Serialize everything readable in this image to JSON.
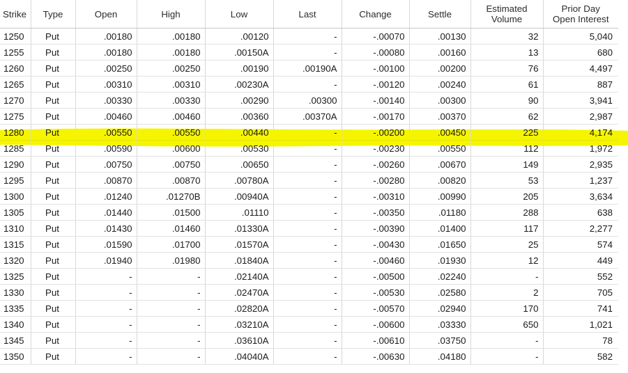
{
  "columns": [
    {
      "label": "Strike",
      "sub": ""
    },
    {
      "label": "Type",
      "sub": ""
    },
    {
      "label": "Open",
      "sub": ""
    },
    {
      "label": "High",
      "sub": ""
    },
    {
      "label": "Low",
      "sub": ""
    },
    {
      "label": "Last",
      "sub": ""
    },
    {
      "label": "Change",
      "sub": ""
    },
    {
      "label": "Settle",
      "sub": ""
    },
    {
      "label": "Estimated",
      "sub": "Volume"
    },
    {
      "label": "Prior Day",
      "sub": "Open Interest"
    }
  ],
  "highlight_color": "#f6f500",
  "highlighted_strike": "1280",
  "rows": [
    {
      "strike": "1250",
      "type": "Put",
      "open": ".00180",
      "high": ".00180",
      "low": ".00120",
      "last": "-",
      "change": "-.00070",
      "settle": ".00130",
      "volume": "32",
      "oi": "5,040"
    },
    {
      "strike": "1255",
      "type": "Put",
      "open": ".00180",
      "high": ".00180",
      "low": ".00150A",
      "last": "-",
      "change": "-.00080",
      "settle": ".00160",
      "volume": "13",
      "oi": "680"
    },
    {
      "strike": "1260",
      "type": "Put",
      "open": ".00250",
      "high": ".00250",
      "low": ".00190",
      "last": ".00190A",
      "change": "-.00100",
      "settle": ".00200",
      "volume": "76",
      "oi": "4,497"
    },
    {
      "strike": "1265",
      "type": "Put",
      "open": ".00310",
      "high": ".00310",
      "low": ".00230A",
      "last": "-",
      "change": "-.00120",
      "settle": ".00240",
      "volume": "61",
      "oi": "887"
    },
    {
      "strike": "1270",
      "type": "Put",
      "open": ".00330",
      "high": ".00330",
      "low": ".00290",
      "last": ".00300",
      "change": "-.00140",
      "settle": ".00300",
      "volume": "90",
      "oi": "3,941"
    },
    {
      "strike": "1275",
      "type": "Put",
      "open": ".00460",
      "high": ".00460",
      "low": ".00360",
      "last": ".00370A",
      "change": "-.00170",
      "settle": ".00370",
      "volume": "62",
      "oi": "2,987"
    },
    {
      "strike": "1280",
      "type": "Put",
      "open": ".00550",
      "high": ".00550",
      "low": ".00440",
      "last": "-",
      "change": "-.00200",
      "settle": ".00450",
      "volume": "225",
      "oi": "4,174"
    },
    {
      "strike": "1285",
      "type": "Put",
      "open": ".00590",
      "high": ".00600",
      "low": ".00530",
      "last": "-",
      "change": "-.00230",
      "settle": ".00550",
      "volume": "112",
      "oi": "1,972"
    },
    {
      "strike": "1290",
      "type": "Put",
      "open": ".00750",
      "high": ".00750",
      "low": ".00650",
      "last": "-",
      "change": "-.00260",
      "settle": ".00670",
      "volume": "149",
      "oi": "2,935"
    },
    {
      "strike": "1295",
      "type": "Put",
      "open": ".00870",
      "high": ".00870",
      "low": ".00780A",
      "last": "-",
      "change": "-.00280",
      "settle": ".00820",
      "volume": "53",
      "oi": "1,237"
    },
    {
      "strike": "1300",
      "type": "Put",
      "open": ".01240",
      "high": ".01270B",
      "low": ".00940A",
      "last": "-",
      "change": "-.00310",
      "settle": ".00990",
      "volume": "205",
      "oi": "3,634"
    },
    {
      "strike": "1305",
      "type": "Put",
      "open": ".01440",
      "high": ".01500",
      "low": ".01110",
      "last": "-",
      "change": "-.00350",
      "settle": ".01180",
      "volume": "288",
      "oi": "638"
    },
    {
      "strike": "1310",
      "type": "Put",
      "open": ".01430",
      "high": ".01460",
      "low": ".01330A",
      "last": "-",
      "change": "-.00390",
      "settle": ".01400",
      "volume": "117",
      "oi": "2,277"
    },
    {
      "strike": "1315",
      "type": "Put",
      "open": ".01590",
      "high": ".01700",
      "low": ".01570A",
      "last": "-",
      "change": "-.00430",
      "settle": ".01650",
      "volume": "25",
      "oi": "574"
    },
    {
      "strike": "1320",
      "type": "Put",
      "open": ".01940",
      "high": ".01980",
      "low": ".01840A",
      "last": "-",
      "change": "-.00460",
      "settle": ".01930",
      "volume": "12",
      "oi": "449"
    },
    {
      "strike": "1325",
      "type": "Put",
      "open": "-",
      "high": "-",
      "low": ".02140A",
      "last": "-",
      "change": "-.00500",
      "settle": ".02240",
      "volume": "-",
      "oi": "552"
    },
    {
      "strike": "1330",
      "type": "Put",
      "open": "-",
      "high": "-",
      "low": ".02470A",
      "last": "-",
      "change": "-.00530",
      "settle": ".02580",
      "volume": "2",
      "oi": "705"
    },
    {
      "strike": "1335",
      "type": "Put",
      "open": "-",
      "high": "-",
      "low": ".02820A",
      "last": "-",
      "change": "-.00570",
      "settle": ".02940",
      "volume": "170",
      "oi": "741"
    },
    {
      "strike": "1340",
      "type": "Put",
      "open": "-",
      "high": "-",
      "low": ".03210A",
      "last": "-",
      "change": "-.00600",
      "settle": ".03330",
      "volume": "650",
      "oi": "1,021"
    },
    {
      "strike": "1345",
      "type": "Put",
      "open": "-",
      "high": "-",
      "low": ".03610A",
      "last": "-",
      "change": "-.00610",
      "settle": ".03750",
      "volume": "-",
      "oi": "78"
    },
    {
      "strike": "1350",
      "type": "Put",
      "open": "-",
      "high": "-",
      "low": ".04040A",
      "last": "-",
      "change": "-.00630",
      "settle": ".04180",
      "volume": "-",
      "oi": "582"
    }
  ]
}
